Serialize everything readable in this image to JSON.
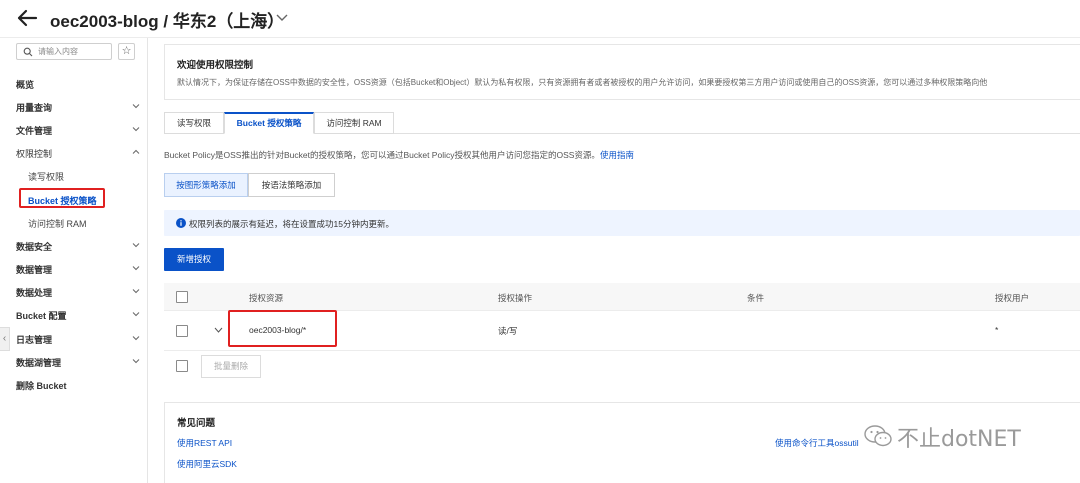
{
  "header": {
    "title": "oec2003-blog / 华东2（上海）"
  },
  "sidebar": {
    "search_placeholder": "请输入内容",
    "star_icon": "☆",
    "items": [
      {
        "label": "概览",
        "expandable": false
      },
      {
        "label": "用量查询",
        "expandable": true
      },
      {
        "label": "文件管理",
        "expandable": true
      },
      {
        "label": "权限控制",
        "expandable": true,
        "expanded": true
      },
      {
        "label": "读写权限",
        "sub": true
      },
      {
        "label": "Bucket 授权策略",
        "sub": true,
        "active": true
      },
      {
        "label": "访问控制 RAM",
        "sub": true
      },
      {
        "label": "数据安全",
        "expandable": true
      },
      {
        "label": "数据管理",
        "expandable": true
      },
      {
        "label": "数据处理",
        "expandable": true
      },
      {
        "label": "Bucket 配置",
        "expandable": true
      },
      {
        "label": "日志管理",
        "expandable": true
      },
      {
        "label": "数据湖管理",
        "expandable": true
      },
      {
        "label": "删除 Bucket",
        "expandable": false
      }
    ]
  },
  "welcome": {
    "title": "欢迎使用权限控制",
    "desc": "默认情况下，为保证存储在OSS中数据的安全性，OSS资源（包括Bucket和Object）默认为私有权限，只有资源拥有者或者被授权的用户允许访问，如果要授权第三方用户访问或使用自己的OSS资源，您可以通过多种权限策略向他"
  },
  "tabs": [
    {
      "label": "读写权限"
    },
    {
      "label": "Bucket 授权策略",
      "active": true
    },
    {
      "label": "访问控制 RAM"
    }
  ],
  "policy": {
    "desc": "Bucket Policy是OSS推出的针对Bucket的授权策略，您可以通过Bucket Policy授权其他用户访问您指定的OSS资源。",
    "guide_link": "使用指南"
  },
  "modes": {
    "graphic": "按图形策略添加",
    "syntax": "按语法策略添加"
  },
  "notice": {
    "text": "权限列表的展示有延迟，将在设置成功15分钟内更新。"
  },
  "actions": {
    "add_auth": "新增授权",
    "batch_delete": "批量删除"
  },
  "table": {
    "columns": [
      "授权资源",
      "授权操作",
      "条件",
      "授权用户"
    ],
    "rows": [
      {
        "resource": "oec2003-blog/*",
        "operation": "读/写",
        "condition": "",
        "user": "*"
      }
    ]
  },
  "faq": {
    "title": "常见问题",
    "links": [
      "使用REST API",
      "使用阿里云SDK",
      "使用命令行工具ossutil"
    ]
  },
  "watermark": {
    "text": "不止dotNET"
  },
  "colors": {
    "primary": "#0a52c8",
    "highlight_box": "#e02020",
    "notice_bg": "#eef4ff"
  }
}
